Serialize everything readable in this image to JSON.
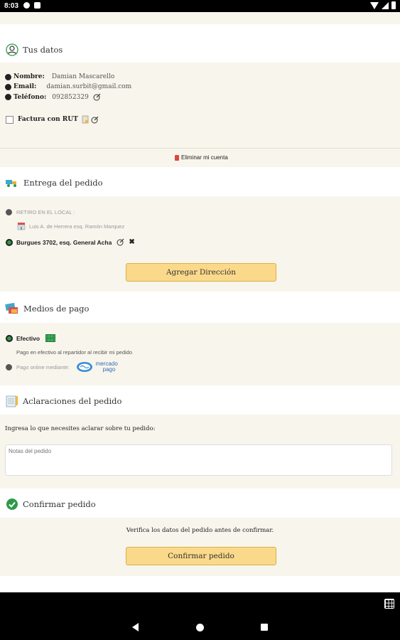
{
  "status_bar": {
    "time": "8:03"
  },
  "tus_datos": {
    "title": "Tus datos",
    "nombre_label": "Nombre:",
    "nombre_value": "Damian Mascarello",
    "email_label": "Email:",
    "email_value": "damian.surbit@gmail.com",
    "telefono_label": "Teléfono:",
    "telefono_value": "092852329",
    "factura_label": "Factura con RUT",
    "eliminar_label": "Eliminar mi cuenta"
  },
  "entrega": {
    "title": "Entrega del pedido",
    "retiro_label": "RETIRO EN EL LOCAL :",
    "retiro_address": "Luis A. de Herrera esq. Ramón Marquez",
    "selected_address": "Burgues 3702, esq. General Acha",
    "add_address_button": "Agregar Dirección"
  },
  "pago": {
    "title": "Medios de pago",
    "efectivo_label": "Efectivo",
    "efectivo_desc": "Pago en efectivo al repartidor al recibir mi pedido",
    "online_label": "Pago online mediante:",
    "mercadopago_line1": "mercado",
    "mercadopago_line2": "pago"
  },
  "aclaraciones": {
    "title": "Aclaraciones del pedido",
    "prompt": "Ingresa lo que necesites aclarar sobre tu pedido:",
    "placeholder": "Notas del pedido"
  },
  "confirmar": {
    "title": "Confirmar pedido",
    "verify_text": "Verifica los datos del pedido antes de confirmar.",
    "button": "Confirmar pedido"
  },
  "colors": {
    "cream": "#f8f5ec",
    "button": "#fbd98a",
    "green": "#2e9a48"
  }
}
